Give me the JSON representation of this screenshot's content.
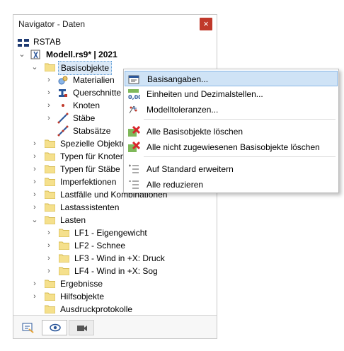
{
  "panel": {
    "title": "Navigator - Daten",
    "close_glyph": "×"
  },
  "tree": {
    "root_label": "RSTAB",
    "model_label": "Modell.rs9* | 2021",
    "basis_label": "Basisobjekte",
    "basis_children": [
      "Materialien",
      "Querschnitte",
      "Knoten",
      "Stäbe",
      "Stabsätze"
    ],
    "top_items": [
      "Spezielle Objekte",
      "Typen für Knoten",
      "Typen für Stäbe",
      "Imperfektionen",
      "Lastfälle und Kombinationen",
      "Lastassistenten"
    ],
    "lasten_label": "Lasten",
    "lasten_children": [
      "LF1 - Eigengewicht",
      "LF2 - Schnee",
      "LF3 - Wind in +X: Druck",
      "LF4 - Wind in +X: Sog"
    ],
    "bottom_items": [
      "Ergebnisse",
      "Hilfsobjekte",
      "Ausdruckprotokolle"
    ]
  },
  "context_menu": {
    "items": [
      {
        "label": "Basisangaben...",
        "icon": "basic-data-icon"
      },
      {
        "label": "Einheiten und Dezimalstellen...",
        "icon": "units-icon"
      },
      {
        "label": "Modelltoleranzen...",
        "icon": "tolerance-icon"
      },
      {
        "label": "Alle Basisobjekte löschen",
        "icon": "delete-all-icon"
      },
      {
        "label": "Alle nicht zugewiesenen Basisobjekte löschen",
        "icon": "delete-unassigned-icon"
      },
      {
        "label": "Auf Standard erweitern",
        "icon": "expand-icon"
      },
      {
        "label": "Alle reduzieren",
        "icon": "collapse-icon"
      }
    ]
  },
  "tabs": [
    "data-tab-icon",
    "view-tab-icon",
    "camera-tab-icon"
  ],
  "colors": {
    "folder": "#f5e08c",
    "accent_blue": "#2b579a",
    "close_red": "#c0392b",
    "highlight": "#cfe3f6"
  }
}
